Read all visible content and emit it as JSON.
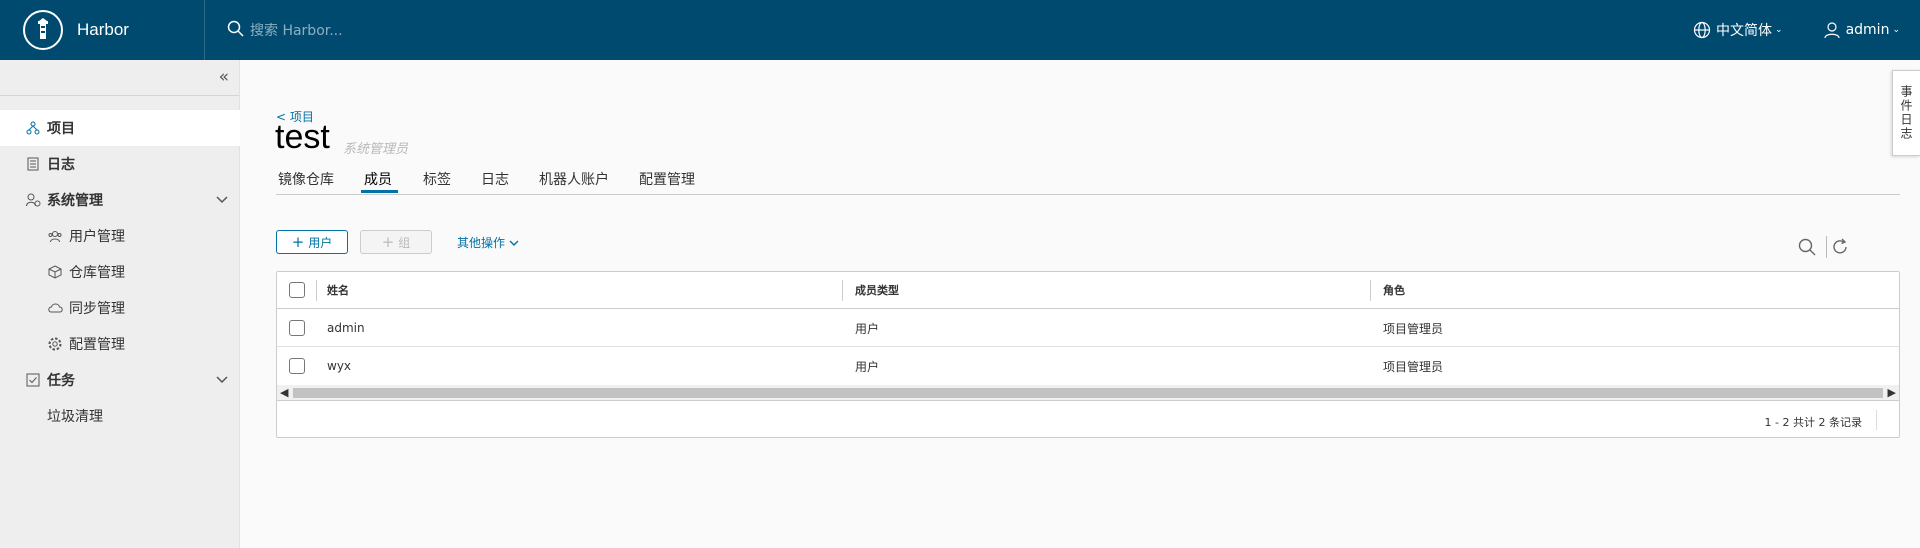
{
  "header": {
    "brand": "Harbor",
    "search_placeholder": "搜索 Harbor...",
    "language": "中文简体",
    "user": "admin"
  },
  "sidebar": {
    "items": [
      {
        "label": "项目",
        "icon": "projects-icon"
      },
      {
        "label": "日志",
        "icon": "logs-icon"
      },
      {
        "label": "系统管理",
        "icon": "system-admin-icon"
      },
      {
        "label": "用户管理",
        "icon": "users-icon"
      },
      {
        "label": "仓库管理",
        "icon": "registry-icon"
      },
      {
        "label": "同步管理",
        "icon": "replication-icon"
      },
      {
        "label": "配置管理",
        "icon": "config-gear-icon"
      },
      {
        "label": "任务",
        "icon": "tasks-icon"
      },
      {
        "label": "垃圾清理",
        "icon": ""
      }
    ]
  },
  "breadcrumb": "< 项目",
  "project": {
    "title": "test",
    "role": "系统管理员"
  },
  "tabs": [
    "镜像仓库",
    "成员",
    "标签",
    "日志",
    "机器人账户",
    "配置管理"
  ],
  "toolbar": {
    "add_user": "用户",
    "add_group": "组",
    "other_actions": "其他操作"
  },
  "table": {
    "columns": [
      "姓名",
      "成员类型",
      "角色"
    ],
    "rows": [
      {
        "name": "admin",
        "type": "用户",
        "role": "项目管理员"
      },
      {
        "name": "wyx",
        "type": "用户",
        "role": "项目管理员"
      }
    ],
    "footer": "1 - 2 共计 2 条记录"
  },
  "event_panel": "事件日志",
  "colors": {
    "header_bg": "#004a70",
    "accent": "#0072a3"
  }
}
